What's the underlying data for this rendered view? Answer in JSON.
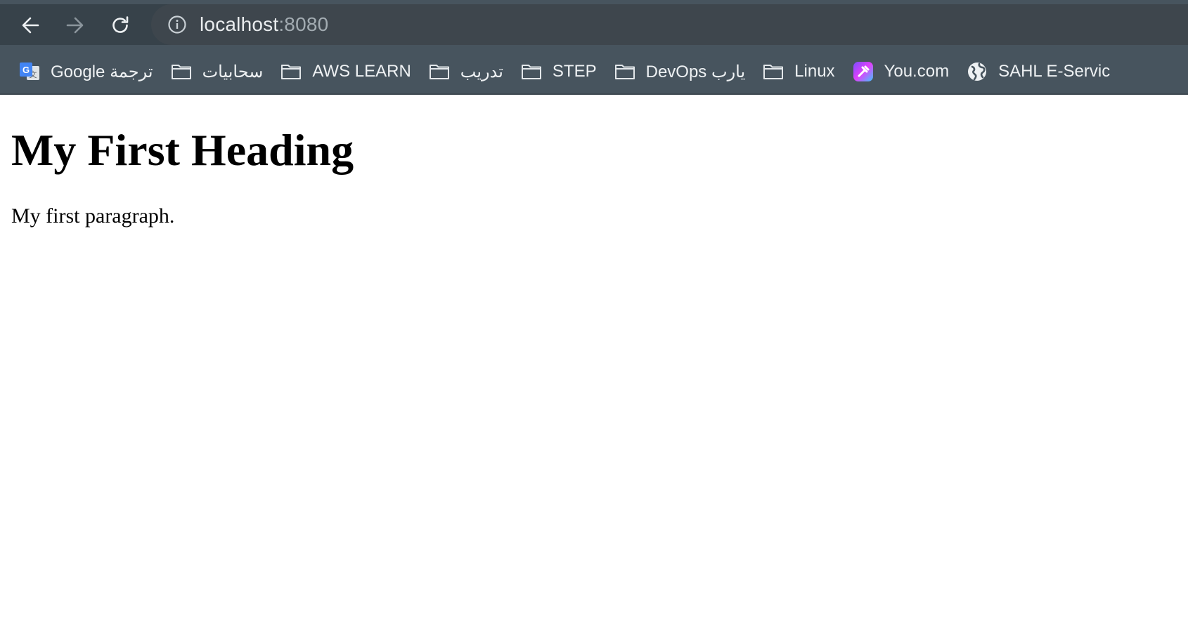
{
  "browser": {
    "url_host": "localhost",
    "url_port": ":8080"
  },
  "bookmarks": [
    {
      "label": "Google ترجمة",
      "icon": "google-translate-icon"
    },
    {
      "label": "سحابيات",
      "icon": "folder-icon"
    },
    {
      "label": "AWS LEARN",
      "icon": "folder-icon"
    },
    {
      "label": "تدريب",
      "icon": "folder-icon"
    },
    {
      "label": "STEP",
      "icon": "folder-icon"
    },
    {
      "label": "DevOps يارب",
      "icon": "folder-icon"
    },
    {
      "label": "Linux",
      "icon": "folder-icon"
    },
    {
      "label": "You.com",
      "icon": "you-com-icon"
    },
    {
      "label": "SAHL E-Servic",
      "icon": "globe-icon"
    }
  ],
  "page": {
    "heading": "My First Heading",
    "paragraph": "My first paragraph."
  },
  "colors": {
    "toolbar_bg": "#47545e",
    "omnibox_bg": "#3e464d",
    "icon_color": "#e9ecee"
  }
}
